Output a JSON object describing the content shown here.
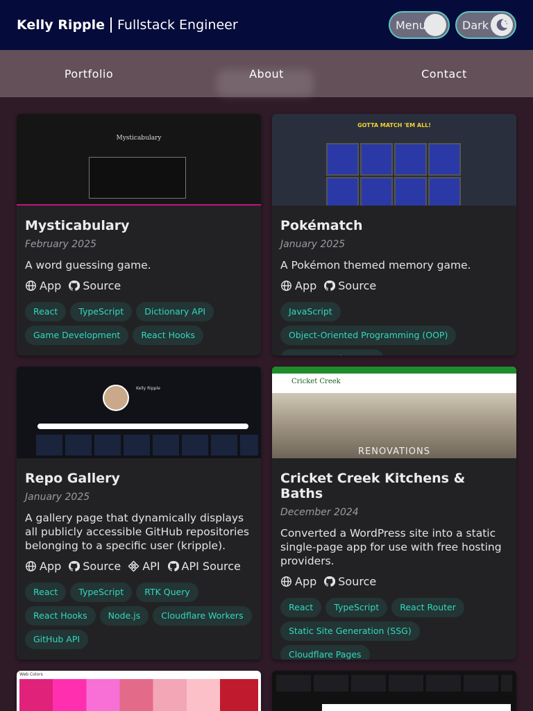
{
  "header": {
    "name": "Kelly Ripple",
    "role": "Fullstack Engineer",
    "menu_toggle": "Menu",
    "theme_toggle": "Dark"
  },
  "nav": {
    "items": [
      "Portfolio",
      "About",
      "Contact"
    ]
  },
  "colors": {
    "header_bg": "#050b3a",
    "nav_bg": "#635058",
    "page_bg": "#2f1b28",
    "card_bg": "#222225",
    "tag_text": "#35d7c0",
    "tag_bg": "#233534",
    "toggle_border": "#5ec7c3"
  },
  "cards": [
    {
      "title": "Mysticabulary",
      "date": "February 2025",
      "description": "A word guessing game.",
      "links": [
        {
          "label": "App",
          "icon": "globe-icon"
        },
        {
          "label": "Source",
          "icon": "github-icon"
        }
      ],
      "tags": [
        "React",
        "TypeScript",
        "Dictionary API",
        "Game Development",
        "React Hooks"
      ],
      "thumb_text": "Mysticabulary"
    },
    {
      "title": "Pokématch",
      "date": "January 2025",
      "description": "A Pokémon themed memory game.",
      "links": [
        {
          "label": "App",
          "icon": "globe-icon"
        },
        {
          "label": "Source",
          "icon": "github-icon"
        }
      ],
      "tags": [
        "JavaScript",
        "Object-Oriented Programming (OOP)",
        "Game Development"
      ],
      "thumb_text": "GOTTA MATCH 'EM ALL!"
    },
    {
      "title": "Repo Gallery",
      "date": "January 2025",
      "description": "A gallery page that dynamically displays all publicly accessible GitHub repositories belonging to a specific user (kripple).",
      "links": [
        {
          "label": "App",
          "icon": "globe-icon"
        },
        {
          "label": "Source",
          "icon": "github-icon"
        },
        {
          "label": "API",
          "icon": "api-icon"
        },
        {
          "label": "API Source",
          "icon": "github-icon"
        }
      ],
      "tags": [
        "React",
        "TypeScript",
        "RTK Query",
        "React Hooks",
        "Node.js",
        "Cloudflare Workers",
        "GitHub API"
      ],
      "thumb_text": "Kelly Ripple"
    },
    {
      "title": "Cricket Creek Kitchens & Baths",
      "date": "December 2024",
      "description": "Converted a WordPress site into a static single-page app for use with free hosting providers.",
      "links": [
        {
          "label": "App",
          "icon": "globe-icon"
        },
        {
          "label": "Source",
          "icon": "github-icon"
        }
      ],
      "tags": [
        "React",
        "TypeScript",
        "React Router",
        "Static Site Generation (SSG)",
        "Cloudflare Pages"
      ],
      "thumb_text": "Cricket Creek",
      "thumb_subtext": "RENOVATIONS"
    }
  ],
  "partial_cards": [
    {
      "thumb_text": "Web Colors"
    },
    {
      "thumb_text": ""
    }
  ]
}
